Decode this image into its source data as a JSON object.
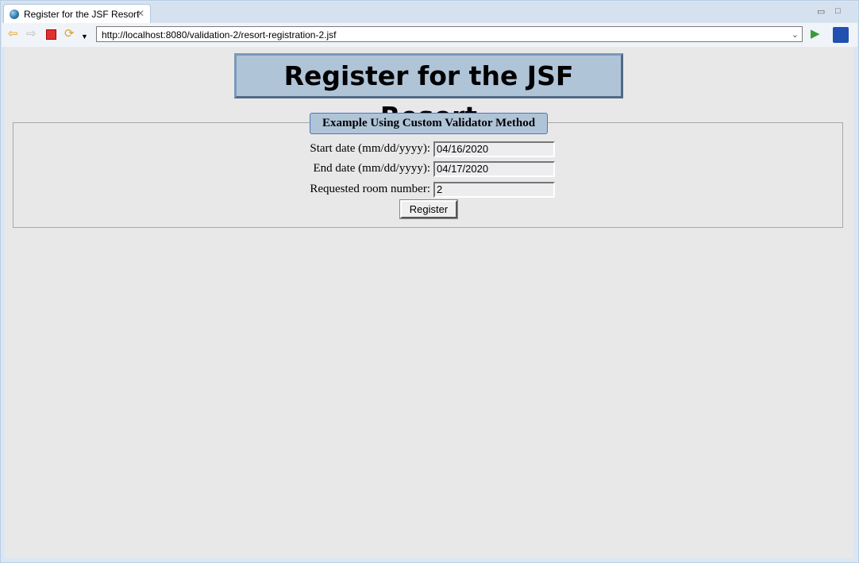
{
  "browser": {
    "tab_title": "Register for the JSF Resort",
    "url": "http://localhost:8080/validation-2/resort-registration-2.jsf"
  },
  "page": {
    "heading": "Register for the JSF Resort",
    "legend": "Example Using Custom Validator Method",
    "fields": [
      {
        "label": "Start date (mm/dd/yyyy):",
        "value": "04/16/2020"
      },
      {
        "label": "End date (mm/dd/yyyy):",
        "value": "04/17/2020"
      },
      {
        "label": "Requested room number:",
        "value": "2"
      }
    ],
    "submit_label": "Register"
  },
  "colors": {
    "heading_bg": "#b0c4d8",
    "page_bg": "#e8e8e8"
  }
}
